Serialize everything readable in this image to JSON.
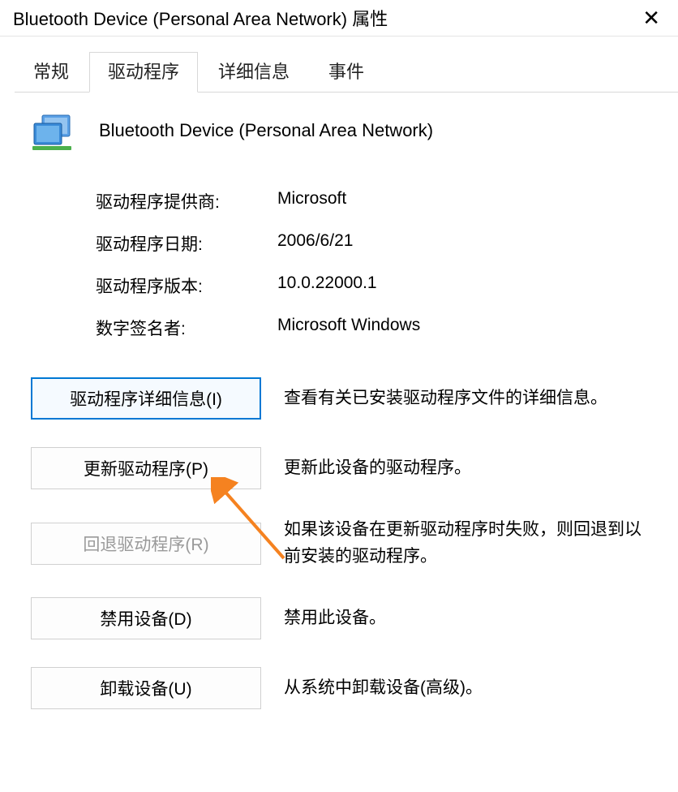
{
  "titlebar": {
    "title": "Bluetooth Device (Personal Area Network) 属性"
  },
  "tabs": {
    "general": "常规",
    "driver": "驱动程序",
    "details": "详细信息",
    "events": "事件"
  },
  "device": {
    "name": "Bluetooth Device (Personal Area Network)"
  },
  "info": {
    "provider_label": "驱动程序提供商:",
    "provider_value": "Microsoft",
    "date_label": "驱动程序日期:",
    "date_value": "2006/6/21",
    "version_label": "驱动程序版本:",
    "version_value": "10.0.22000.1",
    "signer_label": "数字签名者:",
    "signer_value": "Microsoft Windows"
  },
  "buttons": {
    "details_label": "驱动程序详细信息(I)",
    "details_desc": "查看有关已安装驱动程序文件的详细信息。",
    "update_label": "更新驱动程序(P)",
    "update_desc": "更新此设备的驱动程序。",
    "rollback_label": "回退驱动程序(R)",
    "rollback_desc": "如果该设备在更新驱动程序时失败，则回退到以前安装的驱动程序。",
    "disable_label": "禁用设备(D)",
    "disable_desc": "禁用此设备。",
    "uninstall_label": "卸载设备(U)",
    "uninstall_desc": "从系统中卸载设备(高级)。"
  }
}
